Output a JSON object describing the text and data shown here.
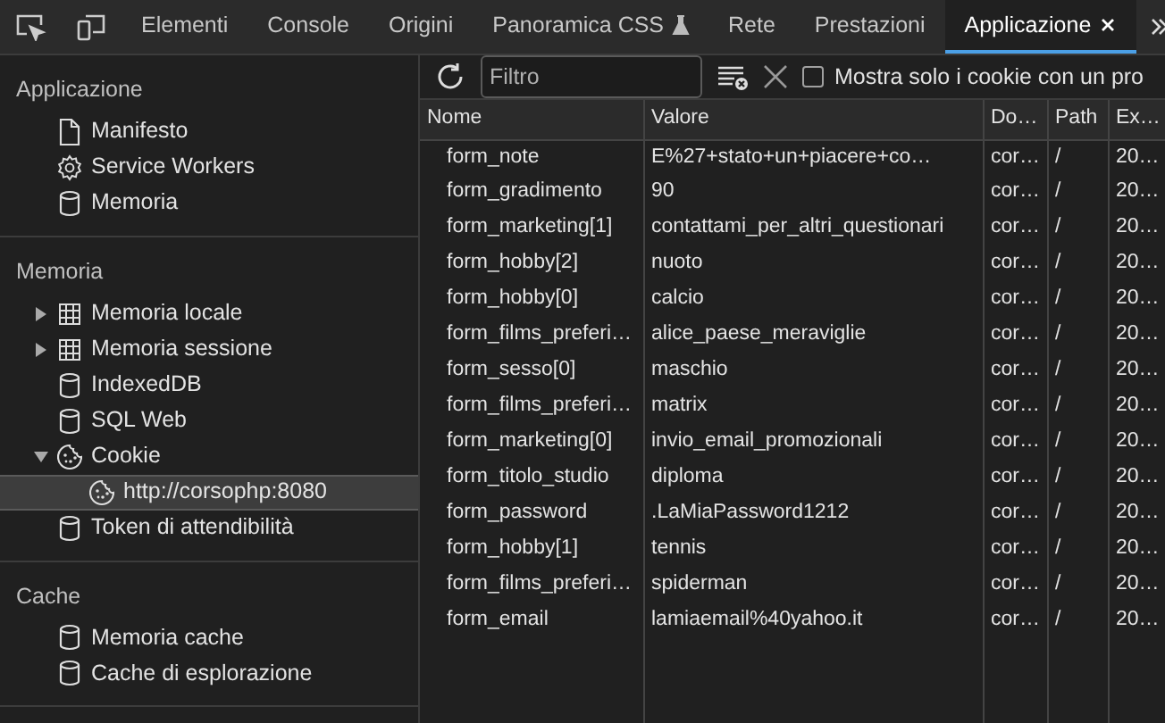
{
  "tabs": [
    {
      "label": "Elementi",
      "selected": false,
      "experimental": false
    },
    {
      "label": "Console",
      "selected": false,
      "experimental": false
    },
    {
      "label": "Origini",
      "selected": false,
      "experimental": false
    },
    {
      "label": "Panoramica CSS",
      "selected": false,
      "experimental": true
    },
    {
      "label": "Rete",
      "selected": false,
      "experimental": false
    },
    {
      "label": "Prestazioni",
      "selected": false,
      "experimental": false
    },
    {
      "label": "Applicazione",
      "selected": true,
      "experimental": false
    }
  ],
  "sidebar": {
    "sections": [
      {
        "title": "Applicazione",
        "items": [
          {
            "label": "Manifesto",
            "kind": "file",
            "selected": false
          },
          {
            "label": "Service Workers",
            "kind": "gear",
            "selected": false
          },
          {
            "label": "Memoria",
            "kind": "database",
            "selected": false
          }
        ]
      },
      {
        "title": "Memoria",
        "items": [
          {
            "label": "Memoria locale",
            "kind": "grid",
            "selected": false,
            "expanded": false
          },
          {
            "label": "Memoria sessione",
            "kind": "grid",
            "selected": false,
            "expanded": false
          },
          {
            "label": "IndexedDB",
            "kind": "database",
            "selected": false
          },
          {
            "label": "SQL Web",
            "kind": "database",
            "selected": false
          },
          {
            "label": "Cookie",
            "kind": "cookie",
            "selected": false,
            "expanded": true,
            "children": [
              {
                "label": "http://corsophp:8080",
                "kind": "cookie",
                "selected": true
              }
            ]
          },
          {
            "label": "Token di attendibilità",
            "kind": "database",
            "selected": false
          }
        ]
      },
      {
        "title": "Cache",
        "items": [
          {
            "label": "Memoria cache",
            "kind": "database",
            "selected": false
          },
          {
            "label": "Cache di esplorazione",
            "kind": "database",
            "selected": false
          }
        ]
      }
    ]
  },
  "filter": {
    "placeholder": "Filtro"
  },
  "only_issues_checkbox": {
    "label": "Mostra solo i cookie con un pro",
    "checked": false
  },
  "table": {
    "columns": [
      "Nome",
      "Valore",
      "Do…",
      "Path",
      "Ex…"
    ],
    "rows": [
      [
        "form_note",
        "E%27+stato+un+piacere+co…",
        "cor…",
        "/",
        "20…"
      ],
      [
        "form_gradimento",
        "90",
        "cor…",
        "/",
        "20…"
      ],
      [
        "form_marketing[1]",
        "contattami_per_altri_questionari",
        "cor…",
        "/",
        "20…"
      ],
      [
        "form_hobby[2]",
        "nuoto",
        "cor…",
        "/",
        "20…"
      ],
      [
        "form_hobby[0]",
        "calcio",
        "cor…",
        "/",
        "20…"
      ],
      [
        "form_films_preferi…",
        "alice_paese_meraviglie",
        "cor…",
        "/",
        "20…"
      ],
      [
        "form_sesso[0]",
        "maschio",
        "cor…",
        "/",
        "20…"
      ],
      [
        "form_films_preferi…",
        "matrix",
        "cor…",
        "/",
        "20…"
      ],
      [
        "form_marketing[0]",
        "invio_email_promozionali",
        "cor…",
        "/",
        "20…"
      ],
      [
        "form_titolo_studio",
        "diploma",
        "cor…",
        "/",
        "20…"
      ],
      [
        "form_password",
        ".LaMiaPassword1212",
        "cor…",
        "/",
        "20…"
      ],
      [
        "form_hobby[1]",
        "tennis",
        "cor…",
        "/",
        "20…"
      ],
      [
        "form_films_preferi…",
        "spiderman",
        "cor…",
        "/",
        "20…"
      ],
      [
        "form_email",
        "lamiaemail%40yahoo.it",
        "cor…",
        "/",
        "20…"
      ]
    ]
  }
}
